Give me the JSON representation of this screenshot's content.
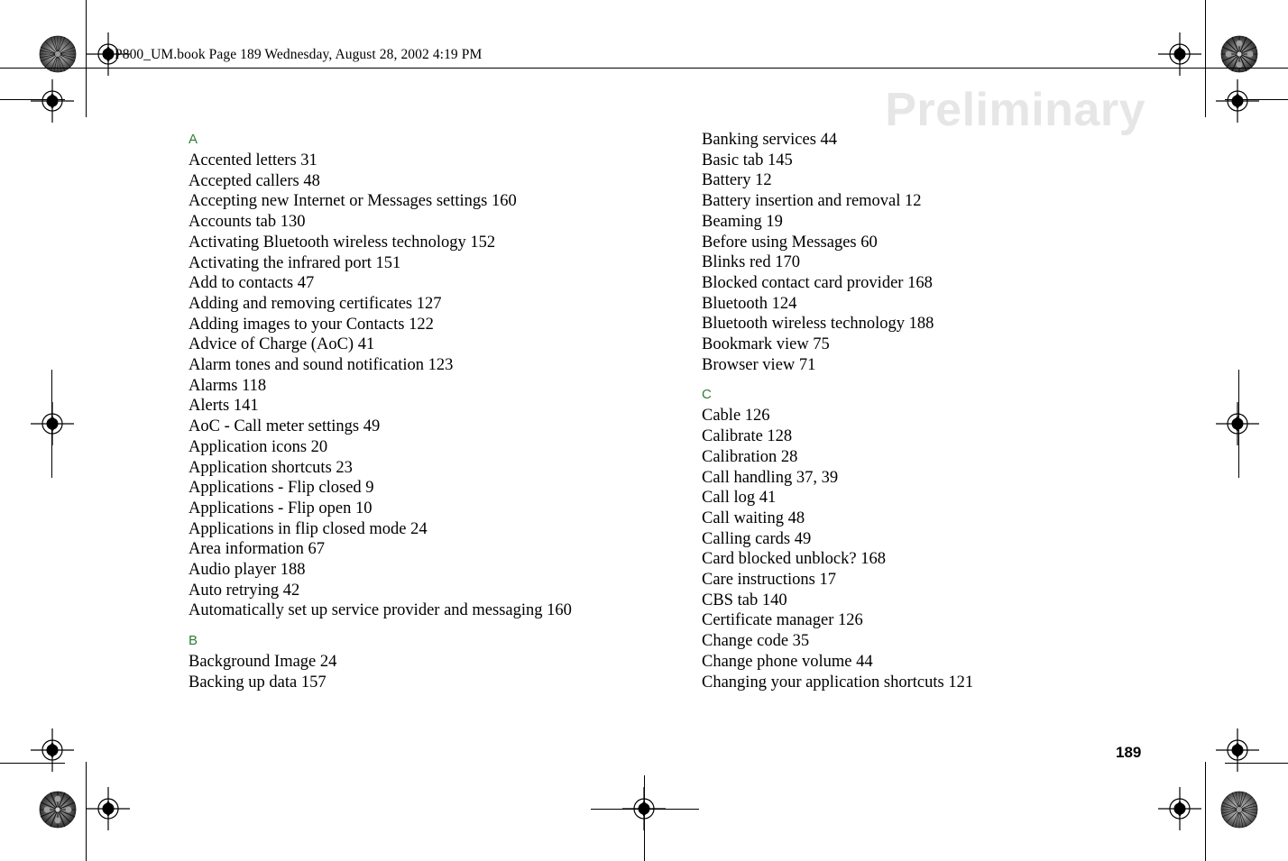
{
  "document": {
    "header_line": "P800_UM.book  Page 189  Wednesday, August 28, 2002  4:19 PM",
    "watermark": "Preliminary",
    "page_number": "189",
    "heading_color": "#2e7d32",
    "watermark_color": "#e6e6e6",
    "text_color": "#000000"
  },
  "index": {
    "columns": [
      {
        "id": "left",
        "sections": [
          {
            "letter": "A",
            "entries": [
              "Accented letters 31",
              "Accepted callers 48",
              "Accepting new Internet or Messages settings 160",
              "Accounts tab 130",
              "Activating Bluetooth wireless technology 152",
              "Activating the infrared port 151",
              "Add to contacts 47",
              "Adding and removing certificates 127",
              "Adding images to your Contacts 122",
              "Advice of Charge (AoC) 41",
              "Alarm tones and sound notification 123",
              "Alarms 118",
              "Alerts 141",
              "AoC - Call meter settings 49",
              "Application icons 20",
              "Application shortcuts 23",
              "Applications - Flip closed 9",
              "Applications - Flip open 10",
              "Applications in flip closed mode 24",
              "Area information 67",
              "Audio player 188",
              "Auto retrying 42",
              "Automatically set up service provider and messaging 160"
            ]
          },
          {
            "letter": "B",
            "entries": [
              "Background Image 24",
              "Backing up data 157"
            ]
          }
        ]
      },
      {
        "id": "right",
        "sections": [
          {
            "letter": "",
            "entries": [
              "Banking services 44",
              "Basic tab 145",
              "Battery 12",
              "Battery insertion and removal 12",
              "Beaming 19",
              "Before using Messages 60",
              "Blinks red 170",
              "Blocked contact card provider 168",
              "Bluetooth 124",
              "Bluetooth wireless technology 188",
              "Bookmark view 75",
              "Browser view 71"
            ]
          },
          {
            "letter": "C",
            "entries": [
              "Cable 126",
              "Calibrate 128",
              "Calibration 28",
              "Call handling 37, 39",
              "Call log 41",
              "Call waiting 48",
              "Calling cards 49",
              "Card blocked unblock? 168",
              "Care instructions 17",
              "CBS tab 140",
              "Certificate manager 126",
              "Change code 35",
              "Change phone volume 44",
              "Changing your application shortcuts 121"
            ]
          }
        ]
      }
    ]
  },
  "print_marks": {
    "registration_icon": "registration-target",
    "rosette_icon": "color-rosette",
    "crop_line_icon": "crop-line"
  }
}
